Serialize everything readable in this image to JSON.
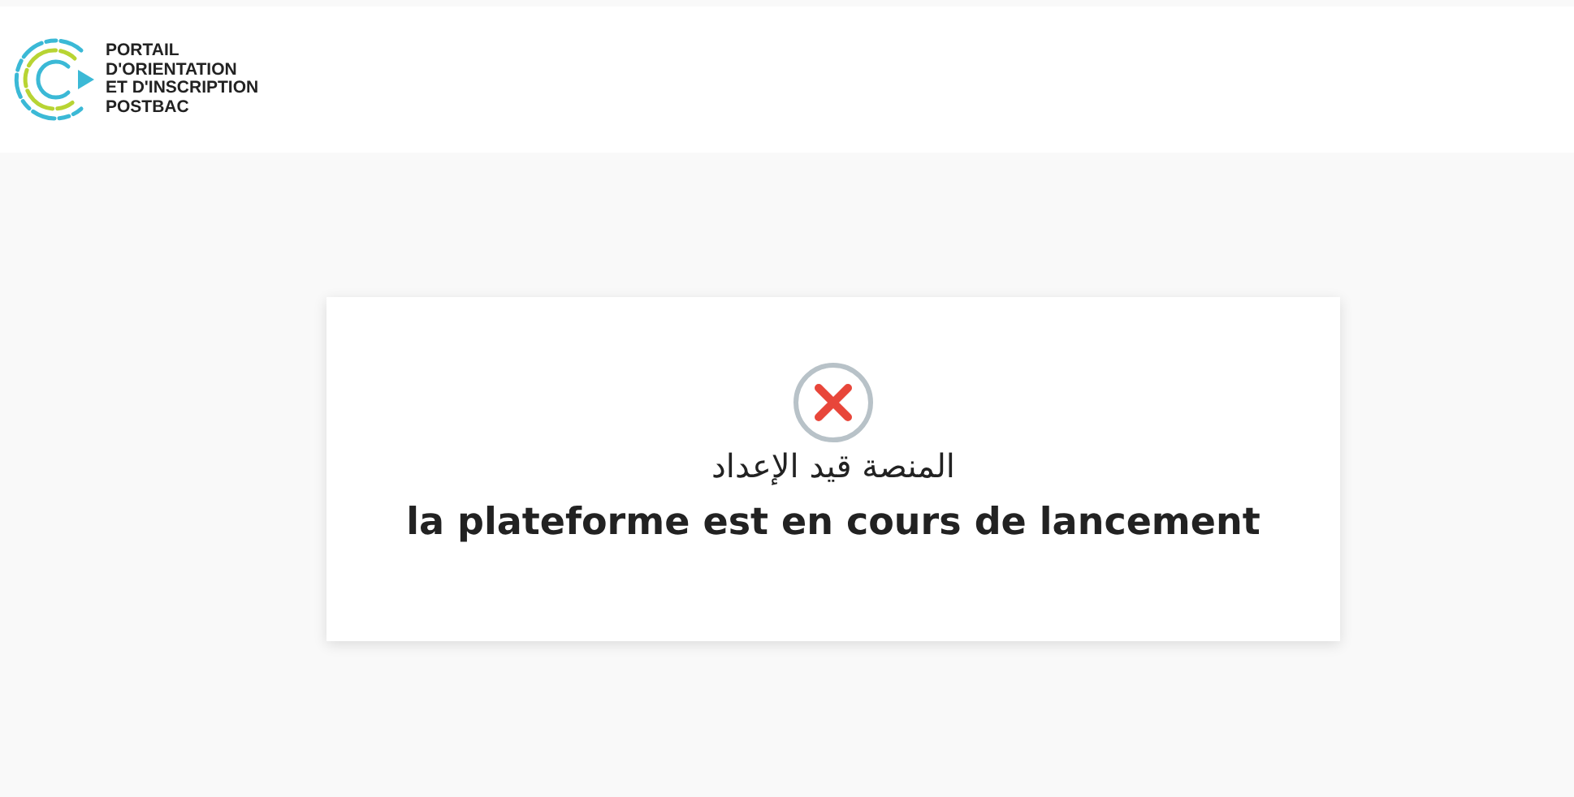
{
  "logo": {
    "lines": [
      "PORTAIL",
      "D'ORIENTATION",
      "ET D'INSCRIPTION",
      "POSTBAC"
    ]
  },
  "message": {
    "kind": "error",
    "title_ar": "المنصة قيد الإعداد",
    "title_fr": "la plateforme est en cours de lancement"
  }
}
